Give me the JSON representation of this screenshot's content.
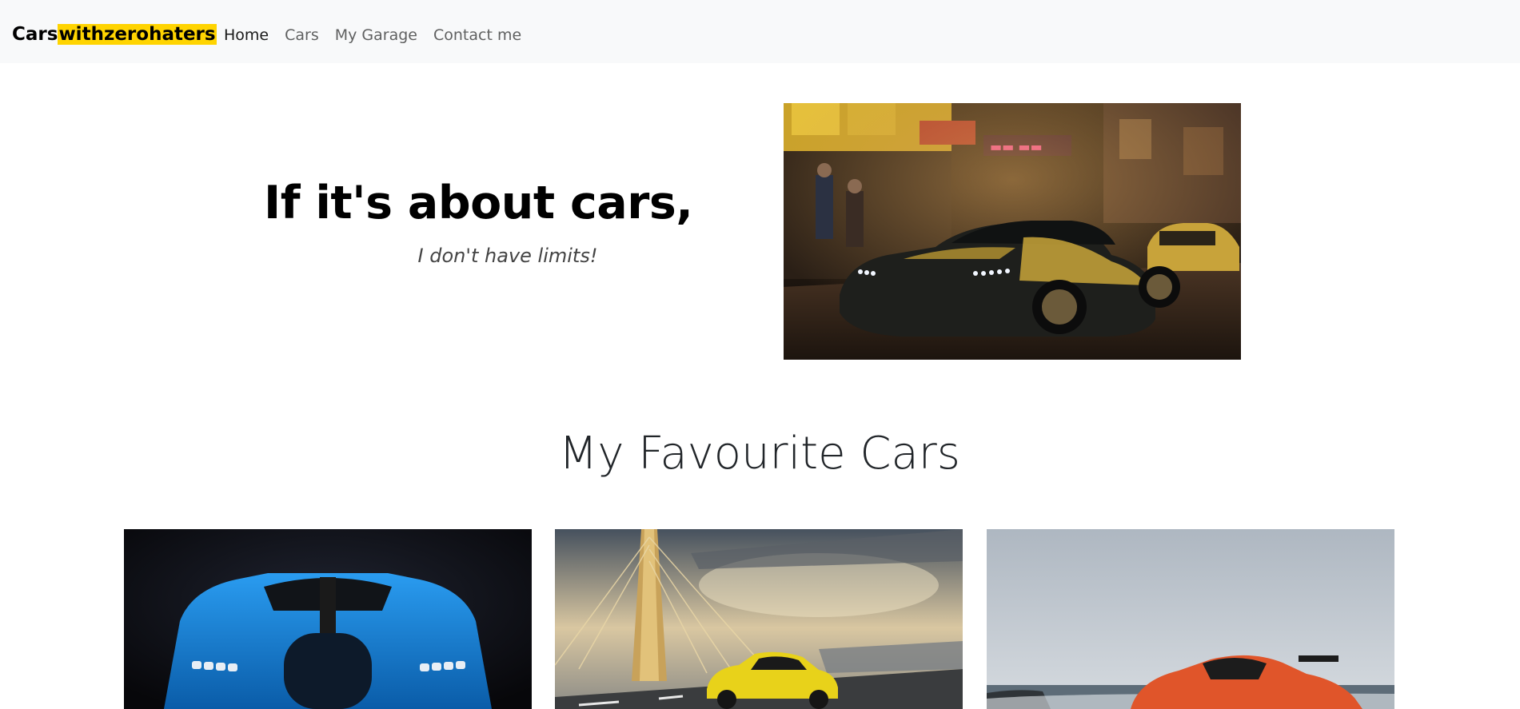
{
  "navbar": {
    "brand_prefix": "Cars",
    "brand_highlight": "withzerohaters",
    "links": [
      {
        "label": "Home",
        "active": true
      },
      {
        "label": "Cars",
        "active": false
      },
      {
        "label": "My Garage",
        "active": false
      },
      {
        "label": "Contact me",
        "active": false
      }
    ]
  },
  "hero": {
    "heading": "If it's about cars,",
    "subheading": "I don't have limits!",
    "image_alt": "black-and-yellow muscle car on a neon-lit city street"
  },
  "favourites": {
    "title": "My Favourite Cars",
    "cards": [
      {
        "image_alt": "blue hypercar front view"
      },
      {
        "image_alt": "yellow sports car on a cable bridge"
      },
      {
        "image_alt": "orange supercar by the sea"
      }
    ]
  },
  "colors": {
    "navbar_bg": "#f8f9fa",
    "brand_highlight": "#ffd400"
  }
}
